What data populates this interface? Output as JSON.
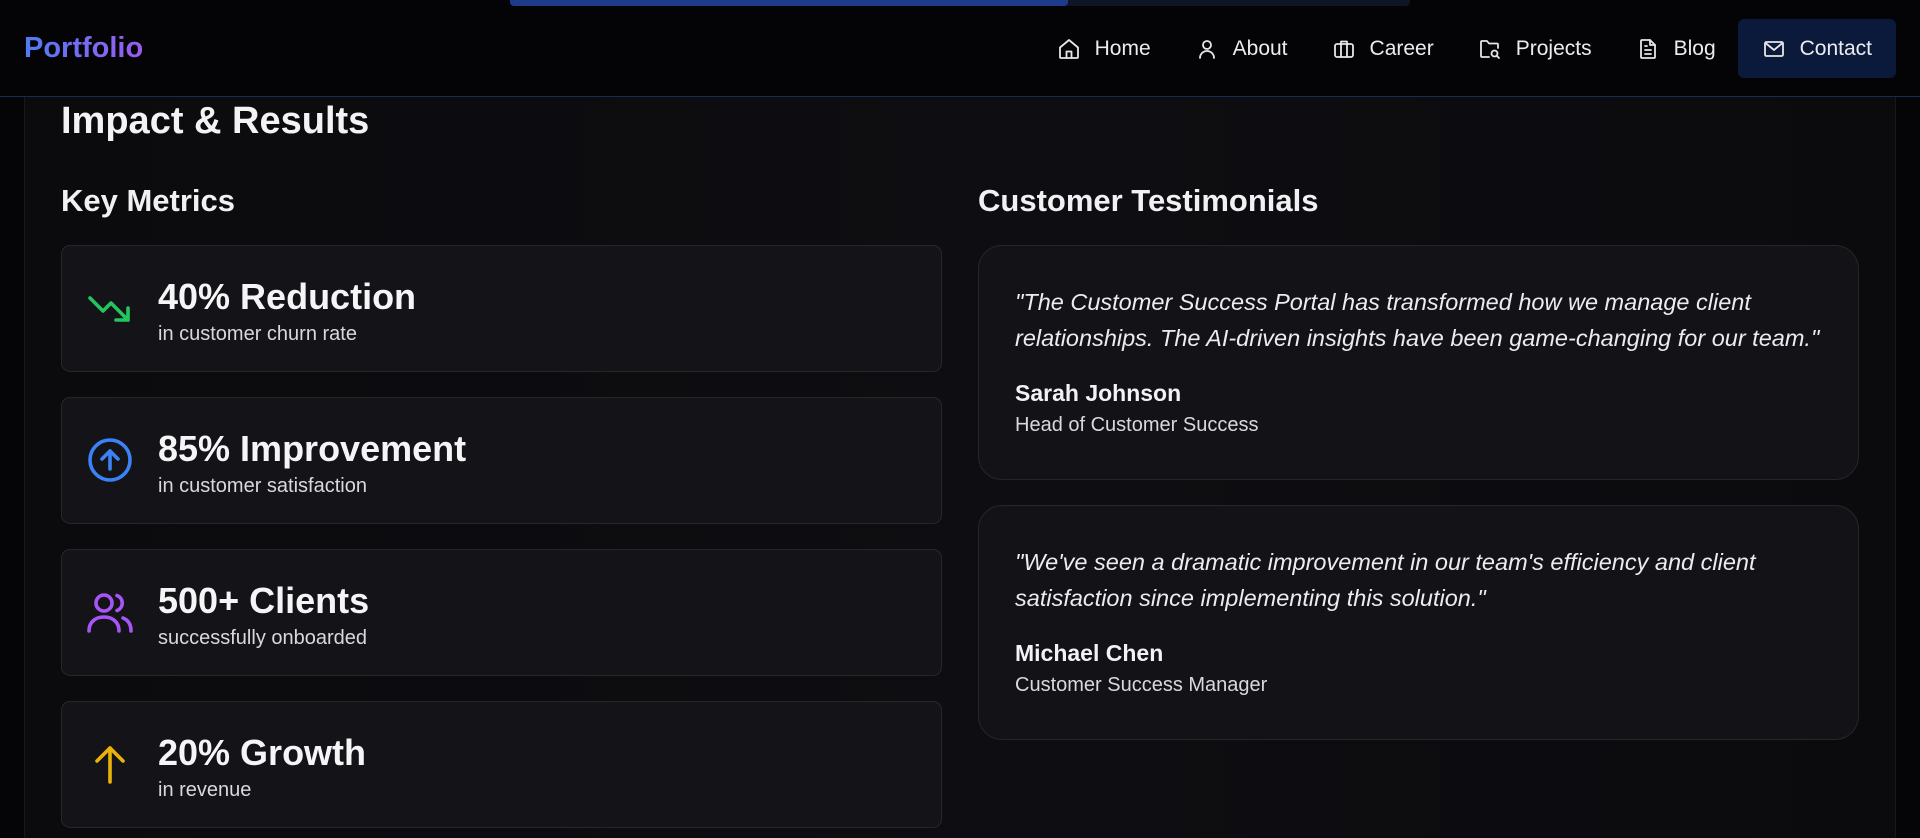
{
  "header": {
    "logo": "Portfolio",
    "nav": [
      {
        "label": "Home",
        "icon": "home-icon"
      },
      {
        "label": "About",
        "icon": "user-icon"
      },
      {
        "label": "Career",
        "icon": "briefcase-icon"
      },
      {
        "label": "Projects",
        "icon": "folder-search-icon"
      },
      {
        "label": "Blog",
        "icon": "document-icon"
      },
      {
        "label": "Contact",
        "icon": "mail-icon",
        "active": true
      }
    ],
    "progress_fraction": 0.62
  },
  "section": {
    "title": "Impact & Results",
    "metrics_title": "Key Metrics",
    "testimonials_title": "Customer Testimonials"
  },
  "metrics": [
    {
      "value": "40% Reduction",
      "label": "in customer churn rate",
      "icon": "trending-down-icon",
      "color": "#22c55e"
    },
    {
      "value": "85% Improvement",
      "label": "in customer satisfaction",
      "icon": "arrow-up-circle-icon",
      "color": "#3b82f6"
    },
    {
      "value": "500+ Clients",
      "label": "successfully onboarded",
      "icon": "users-icon",
      "color": "#a855f7"
    },
    {
      "value": "20% Growth",
      "label": "in revenue",
      "icon": "arrow-up-icon",
      "color": "#eab308"
    }
  ],
  "testimonials": [
    {
      "quote": "\"The Customer Success Portal has transformed how we manage client relationships. The AI-driven insights have been game-changing for our team.\"",
      "author": "Sarah Johnson",
      "role": "Head of Customer Success"
    },
    {
      "quote": "\"We've seen a dramatic improvement in our team's efficiency and client satisfaction since implementing this solution.\"",
      "author": "Michael Chen",
      "role": "Customer Success Manager"
    }
  ]
}
